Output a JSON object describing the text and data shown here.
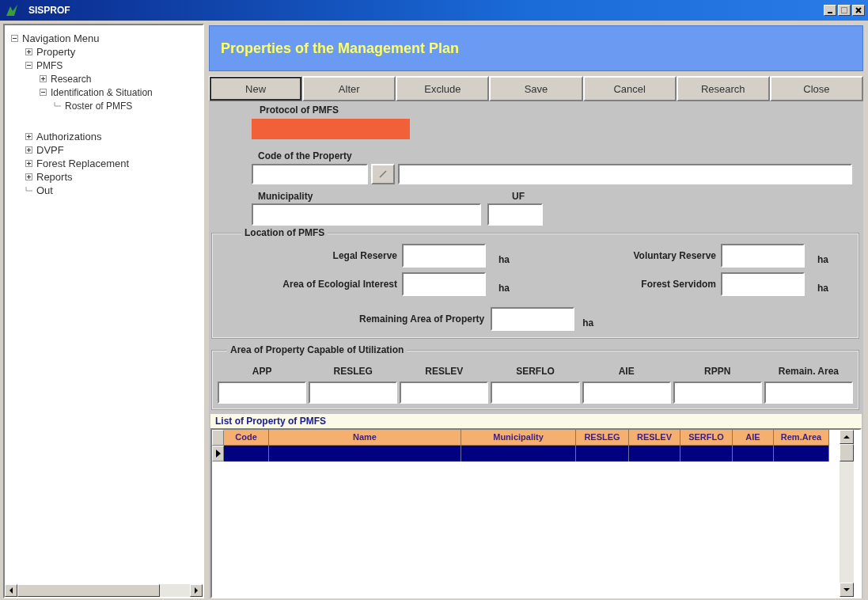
{
  "window": {
    "title": "SISPROF"
  },
  "navigation": {
    "label": "Navigation Menu",
    "expanded": true,
    "children": [
      {
        "label": "Property",
        "expanded": false
      },
      {
        "label": "PMFS",
        "expanded": true,
        "children": [
          {
            "label": "Research",
            "expanded": false
          },
          {
            "label": "Identification & Situation",
            "expanded": true,
            "children": [
              {
                "label": "Roster of PMFS"
              }
            ]
          }
        ]
      },
      {
        "label": "Authorizations",
        "expanded": false
      },
      {
        "label": "DVPF",
        "expanded": false
      },
      {
        "label": "Forest Replacement",
        "expanded": false
      },
      {
        "label": "Reports",
        "expanded": false
      },
      {
        "label": "Out"
      }
    ]
  },
  "header": {
    "title": "Properties of the Management Plan"
  },
  "toolbar": [
    {
      "label": "New",
      "default": true
    },
    {
      "label": "Alter",
      "default": false
    },
    {
      "label": "Exclude",
      "default": false
    },
    {
      "label": "Save",
      "default": false
    },
    {
      "label": "Cancel",
      "default": false
    },
    {
      "label": "Research",
      "default": false
    },
    {
      "label": "Close",
      "default": false
    }
  ],
  "form": {
    "protocol": {
      "label": "Protocol of PMFS",
      "highlighted": true
    },
    "property_code": {
      "label": "Code of the Property"
    },
    "municipality": {
      "label": "Municipality"
    },
    "uf": {
      "label": "UF"
    }
  },
  "location": {
    "title": "Location of  PMFS",
    "fields": [
      {
        "label": "Legal Reserve",
        "unit": "ha"
      },
      {
        "label": "Voluntary Reserve",
        "unit": "ha"
      },
      {
        "label": "Area of Ecologial Interest",
        "unit": "ha"
      },
      {
        "label": "Forest Servidom",
        "unit": "ha"
      },
      {
        "label": "Remaining Area of Property",
        "unit": "ha"
      }
    ]
  },
  "utilization": {
    "title": "Area of Property Capable of Utilization",
    "columns": [
      "APP",
      "RESLEG",
      "RESLEV",
      "SERFLO",
      "AIE",
      "RPPN",
      "Remain. Area"
    ]
  },
  "list": {
    "title": "List of Property of PMFS",
    "columns": [
      "Code",
      "Name",
      "Municipality",
      "RESLEG",
      "RESLEV",
      "SERFLO",
      "AIE",
      "Rem.Area"
    ],
    "rows": [
      {
        "selected": true
      }
    ]
  }
}
